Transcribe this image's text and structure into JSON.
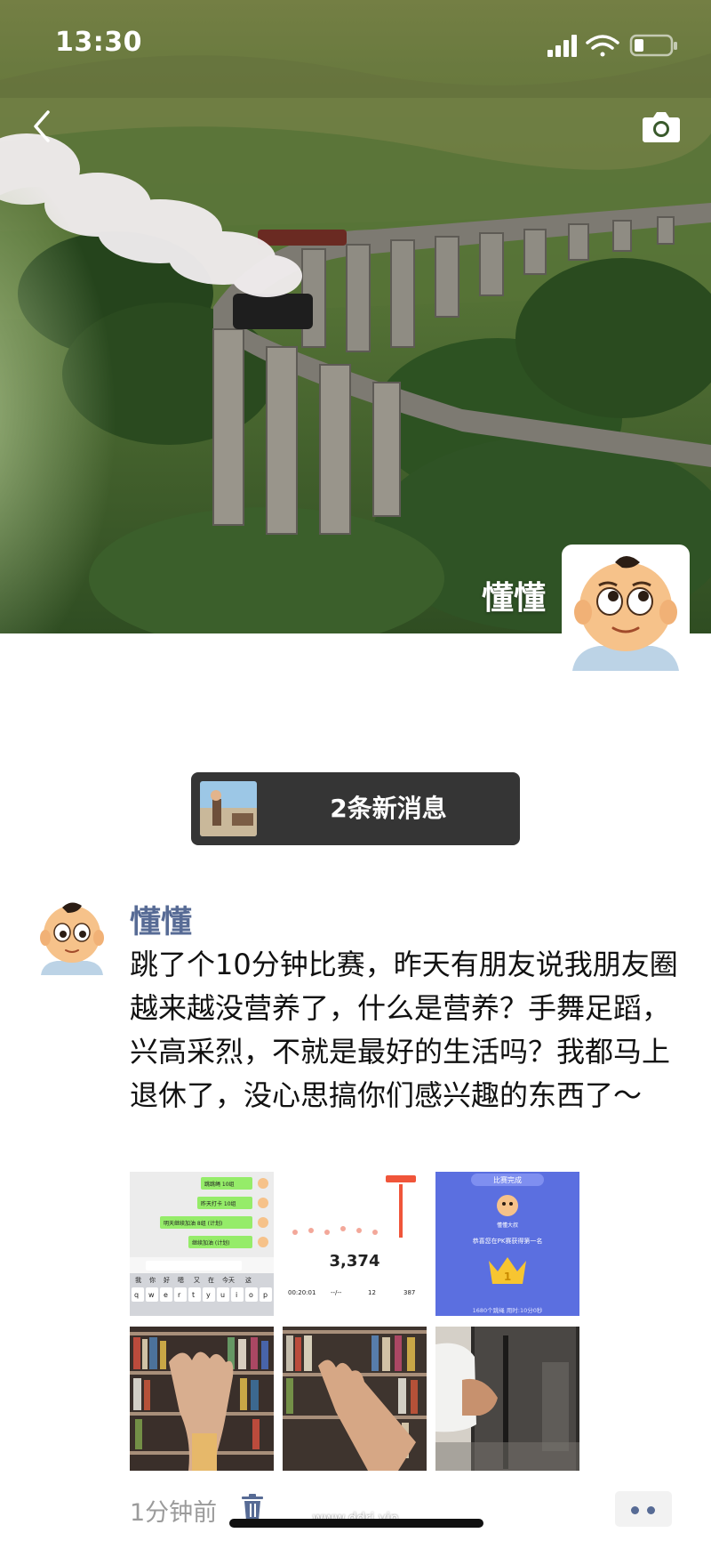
{
  "status_bar": {
    "time": "13:30"
  },
  "cover": {
    "user_name": "懂懂",
    "back_icon": "chevron-left-icon",
    "camera_icon": "camera-icon"
  },
  "new_message": {
    "label": "2条新消息"
  },
  "post": {
    "author": "懂懂",
    "text": "跳了个10分钟比赛，昨天有朋友说我朋友圈越来越没营养了，什么是营养？手舞足蹈，兴高采烈，不就是最好的生活吗？我都马上退休了，没心思搞你们感兴趣的东西了～",
    "time": "1分钟前",
    "delete_icon": "trash-icon",
    "more_icon": "more-dots-icon",
    "photos": [
      {
        "kind": "chat-screenshot",
        "bubbles": [
          "跳跳绳 10组",
          "昨天打卡 10组",
          "明天继续加油 8组 (计划)",
          "继续加油 (计划)"
        ],
        "keyboard_suggestions": [
          "我",
          "你",
          "好",
          "嗯",
          "又",
          "在",
          "今天",
          "这"
        ],
        "keyboard_keys": [
          "q",
          "w",
          "e",
          "r",
          "t",
          "y",
          "u",
          "i",
          "o",
          "p"
        ]
      },
      {
        "kind": "jump-rope-stats",
        "count": "3,374",
        "stats": [
          "00:20:01",
          "--/--",
          "12",
          "387"
        ]
      },
      {
        "kind": "contest-result",
        "header": "比赛完成",
        "name": "懂懂大叔",
        "message": "恭喜您在PK赛获得第一名",
        "rank": "1",
        "footer": "1680个跳绳 用时:10分0秒"
      },
      {
        "kind": "photo-hand-bookshelf-1"
      },
      {
        "kind": "photo-hand-bookshelf-2"
      },
      {
        "kind": "photo-mirror"
      }
    ]
  },
  "watermark": "www.ddrj.vip",
  "colors": {
    "link_blue": "#576b95",
    "pill_bg": "#353535",
    "meta_gray": "#9b9b9b"
  }
}
